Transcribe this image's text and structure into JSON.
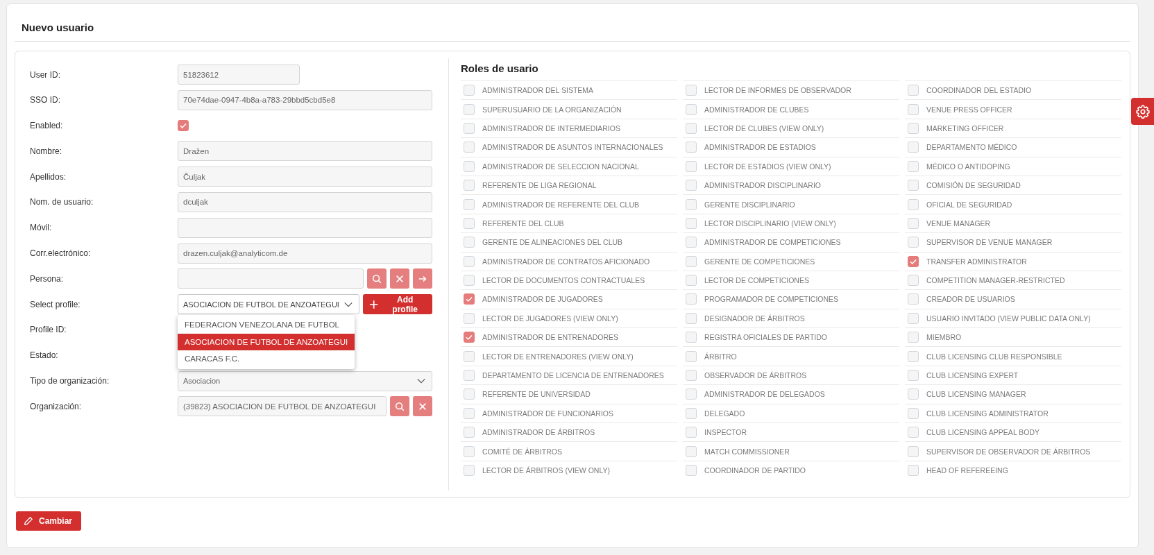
{
  "page": {
    "title": "Nuevo usuario"
  },
  "form": {
    "fields": [
      {
        "kind": "short-text",
        "label": "User ID:",
        "value": "51823612"
      },
      {
        "kind": "text",
        "label": "SSO ID:",
        "value": "70e74dae-0947-4b8a-a783-29bbd5cbd5e8"
      },
      {
        "kind": "checkbox",
        "label": "Enabled:",
        "checked": true
      },
      {
        "kind": "text",
        "label": "Nombre:",
        "value": "Dražen"
      },
      {
        "kind": "text",
        "label": "Apellidos:",
        "value": "Čuljak"
      },
      {
        "kind": "text",
        "label": "Nom. de usuario:",
        "value": "dculjak"
      },
      {
        "kind": "text",
        "label": "Móvil:"
      },
      {
        "kind": "text",
        "label": "Corr.electrónico:",
        "value": "drazen.culjak@analyticom.de"
      },
      {
        "kind": "lookup3",
        "label": "Persona:"
      },
      {
        "kind": "profile-select",
        "label": "Select profile:",
        "value": "ASOCIACION DE FUTBOL DE ANZOATEGUI",
        "button": "Add profile"
      },
      {
        "kind": "label",
        "label": "Profile ID:"
      },
      {
        "kind": "label",
        "label": "Estado:"
      },
      {
        "kind": "select",
        "label": "Tipo de organización:",
        "value": "Asociacion"
      },
      {
        "kind": "lookup2",
        "label": "Organización:",
        "value": "(39823) ASOCIACION DE FUTBOL DE ANZOATEGUI"
      }
    ],
    "dropdown": {
      "options": [
        {
          "label": "FEDERACION VENEZOLANA DE FUTBOL",
          "selected": false
        },
        {
          "label": "ASOCIACION DE FUTBOL DE ANZOATEGUI",
          "selected": true
        },
        {
          "label": "CARACAS F.C.",
          "selected": false
        }
      ]
    }
  },
  "roles": {
    "title": "Roles de usario",
    "columns": [
      [
        {
          "label": "ADMINISTRADOR DEL SISTEMA",
          "checked": false
        },
        {
          "label": "SUPERUSUARIO DE LA ORGANIZACIÓN",
          "checked": false
        },
        {
          "label": "ADMINISTRADOR DE INTERMEDIARIOS",
          "checked": false
        },
        {
          "label": "ADMINISTRADOR DE ASUNTOS INTERNACIONALES",
          "checked": false
        },
        {
          "label": "ADMINISTRADOR DE SELECCION NACIONAL",
          "checked": false
        },
        {
          "label": "REFERENTE DE LIGA REGIONAL",
          "checked": false
        },
        {
          "label": "ADMINISTRADOR DE REFERENTE DEL CLUB",
          "checked": false
        },
        {
          "label": "REFERENTE DEL CLUB",
          "checked": false
        },
        {
          "label": "GERENTE DE ALINEACIONES DEL CLUB",
          "checked": false
        },
        {
          "label": "ADMINISTRADOR DE CONTRATOS AFICIONADO",
          "checked": false
        },
        {
          "label": "LECTOR DE DOCUMENTOS CONTRACTUALES",
          "checked": false
        },
        {
          "label": "ADMINISTRADOR DE JUGADORES",
          "checked": true
        },
        {
          "label": "LECTOR DE JUGADORES (VIEW ONLY)",
          "checked": false
        },
        {
          "label": "ADMINISTRADOR DE ENTRENADORES",
          "checked": true
        },
        {
          "label": "LECTOR DE ENTRENADORES (VIEW ONLY)",
          "checked": false
        },
        {
          "label": "DEPARTAMENTO DE LICENCIA DE ENTRENADORES",
          "checked": false
        },
        {
          "label": "REFERENTE DE UNIVERSIDAD",
          "checked": false
        },
        {
          "label": "ADMINISTRADOR DE FUNCIONARIOS",
          "checked": false
        },
        {
          "label": "ADMINISTRADOR DE ÁRBITROS",
          "checked": false
        },
        {
          "label": "COMITÉ DE ÁRBITROS",
          "checked": false
        },
        {
          "label": "LECTOR DE ÁRBITROS (VIEW ONLY)",
          "checked": false
        }
      ],
      [
        {
          "label": "LECTOR DE INFORMES DE OBSERVADOR",
          "checked": false
        },
        {
          "label": "ADMINISTRADOR DE CLUBES",
          "checked": false
        },
        {
          "label": "LECTOR DE CLUBES (VIEW ONLY)",
          "checked": false
        },
        {
          "label": "ADMINISTRADOR DE ESTADIOS",
          "checked": false
        },
        {
          "label": "LECTOR DE ESTADIOS (VIEW ONLY)",
          "checked": false
        },
        {
          "label": "ADMINISTRADOR DISCIPLINARIO",
          "checked": false
        },
        {
          "label": "GERENTE DISCIPLINARIO",
          "checked": false
        },
        {
          "label": "LECTOR DISCIPLINARIO (VIEW ONLY)",
          "checked": false
        },
        {
          "label": "ADMINISTRADOR DE COMPETICIONES",
          "checked": false
        },
        {
          "label": "GERENTE DE COMPETICIONES",
          "checked": false
        },
        {
          "label": "LECTOR DE COMPETICIONES",
          "checked": false
        },
        {
          "label": "PROGRAMADOR DE COMPETICIONES",
          "checked": false
        },
        {
          "label": "DESIGNADOR DE ÁRBITROS",
          "checked": false
        },
        {
          "label": "REGISTRA OFICIALES DE PARTIDO",
          "checked": false
        },
        {
          "label": "ÁRBITRO",
          "checked": false
        },
        {
          "label": "OBSERVADOR DE ÁRBITROS",
          "checked": false
        },
        {
          "label": "ADMINISTRADOR DE DELEGADOS",
          "checked": false
        },
        {
          "label": "DELEGADO",
          "checked": false
        },
        {
          "label": "INSPECTOR",
          "checked": false
        },
        {
          "label": "MATCH COMMISSIONER",
          "checked": false
        },
        {
          "label": "COORDINADOR DE PARTIDO",
          "checked": false
        }
      ],
      [
        {
          "label": "COORDINADOR DEL ESTADIO",
          "checked": false
        },
        {
          "label": "VENUE PRESS OFFICER",
          "checked": false
        },
        {
          "label": "MARKETING OFFICER",
          "checked": false
        },
        {
          "label": "DEPARTAMENTO MÉDICO",
          "checked": false
        },
        {
          "label": "MÉDICO O ANTIDOPING",
          "checked": false
        },
        {
          "label": "COMISIÓN DE SEGURIDAD",
          "checked": false
        },
        {
          "label": "OFICIAL DE SEGURIDAD",
          "checked": false
        },
        {
          "label": "VENUE MANAGER",
          "checked": false
        },
        {
          "label": "SUPERVISOR DE VENUE MANAGER",
          "checked": false
        },
        {
          "label": "TRANSFER ADMINISTRATOR",
          "checked": true
        },
        {
          "label": "COMPETITION MANAGER-RESTRICTED",
          "checked": false
        },
        {
          "label": "CREADOR DE USUARIOS",
          "checked": false
        },
        {
          "label": "USUARIO INVITADO (VIEW PUBLIC DATA ONLY)",
          "checked": false
        },
        {
          "label": "MIEMBRO",
          "checked": false
        },
        {
          "label": "CLUB LICENSING CLUB RESPONSIBLE",
          "checked": false
        },
        {
          "label": "CLUB LICENSING EXPERT",
          "checked": false
        },
        {
          "label": "CLUB LICENSING MANAGER",
          "checked": false
        },
        {
          "label": "CLUB LICENSING ADMINISTRATOR",
          "checked": false
        },
        {
          "label": "CLUB LICENSING APPEAL BODY",
          "checked": false
        },
        {
          "label": "SUPERVISOR DE OBSERVADOR DE ÁRBITROS",
          "checked": false
        },
        {
          "label": "HEAD OF REFEREEING",
          "checked": false
        }
      ]
    ]
  },
  "actions": {
    "save_button": "Cambiar"
  }
}
